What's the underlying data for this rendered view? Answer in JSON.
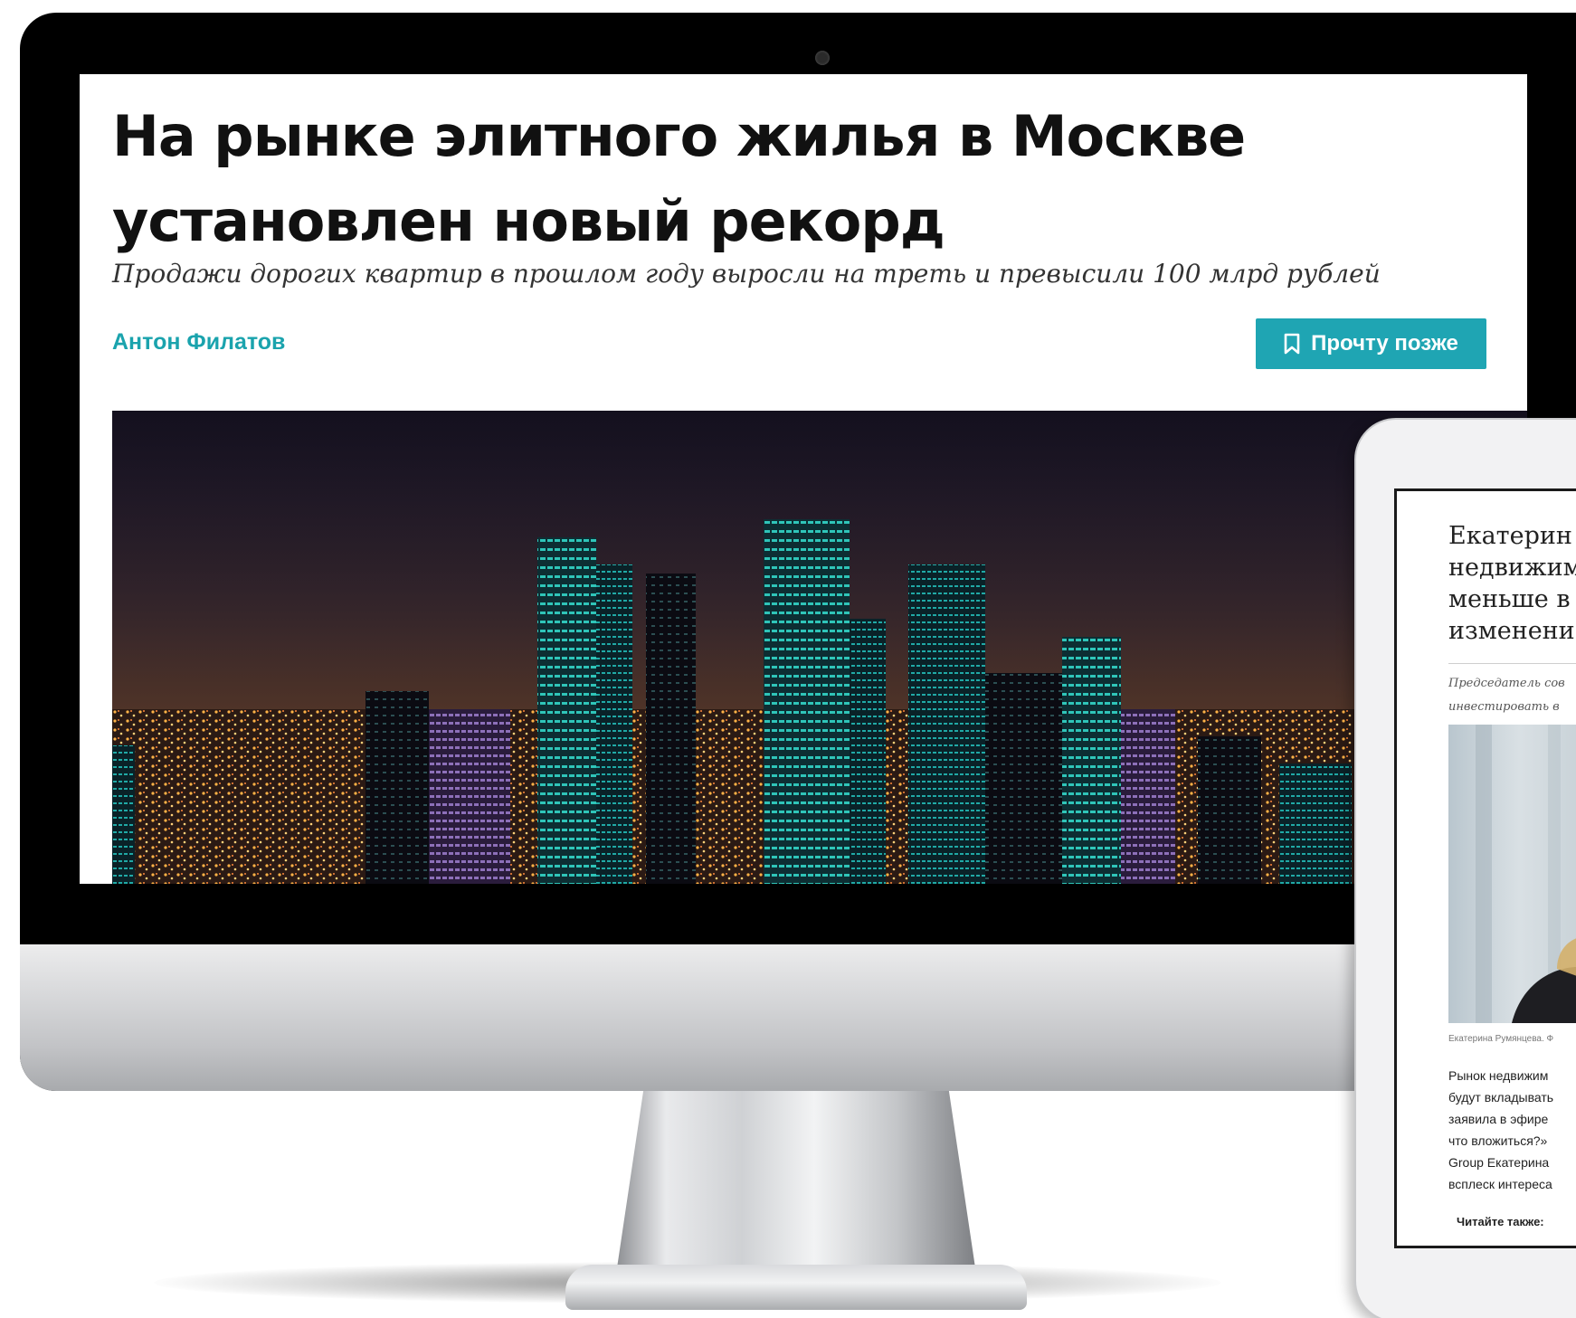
{
  "desktop": {
    "article": {
      "title": "На рынке элитного жилья в Москве установлен новый рекорд",
      "subtitle": "Продажи дорогих квартир в прошлом году выросли на треть и превысили 100 млрд рублей",
      "author": "Антон Филатов",
      "read_later_label": "Прочту позже"
    }
  },
  "tablet": {
    "article": {
      "title": "Екатерин\nнедвижим\nменьше в\nизменени",
      "lead": "Председатель сов\nинвестировать в",
      "caption": "Екатерина Румянцева. Ф",
      "body": "Рынок недвижим\nбудут вкладывать\nзаявила в эфире\nчто вложиться?»\nGroup Екатерина\nвсплеск интереса",
      "read_also_label": "Читайте также:"
    }
  },
  "colors": {
    "accent": "#1fa5b3",
    "author_link": "#1aa3ad",
    "title_text": "#111111"
  },
  "icons": {
    "read_later": "bookmark-icon"
  }
}
